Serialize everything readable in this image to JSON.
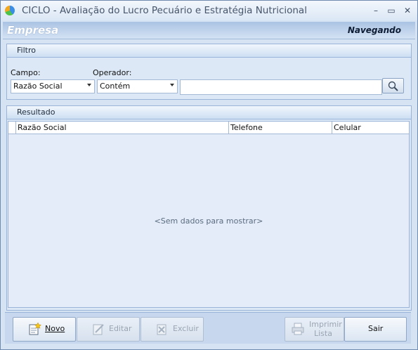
{
  "window": {
    "title": "CICLO - Avaliação do Lucro Pecuário e Estratégia Nutricional",
    "minimize_glyph": "–",
    "maximize_glyph": "▭",
    "close_glyph": "✕"
  },
  "header": {
    "title": "Empresa",
    "status": "Navegando"
  },
  "filter": {
    "group_title": "Filtro",
    "field_label": "Campo:",
    "field_value": "Razão Social",
    "operator_label": "Operador:",
    "operator_value": "Contém",
    "search_value": "",
    "search_icon": "magnifier-icon"
  },
  "results": {
    "group_title": "Resultado",
    "columns": [
      "Razão Social",
      "Telefone",
      "Celular"
    ],
    "rows": [],
    "empty_message": "<Sem dados para mostrar>"
  },
  "toolbar": {
    "new_label": "Novo",
    "edit_label": "Editar",
    "delete_label": "Excluir",
    "print_label_line1": "Imprimir",
    "print_label_line2": "Lista",
    "exit_label": "Sair"
  },
  "colors": {
    "accent": "#99b4d8",
    "header_band": "#aac3e3",
    "panel": "#dce8f6"
  }
}
